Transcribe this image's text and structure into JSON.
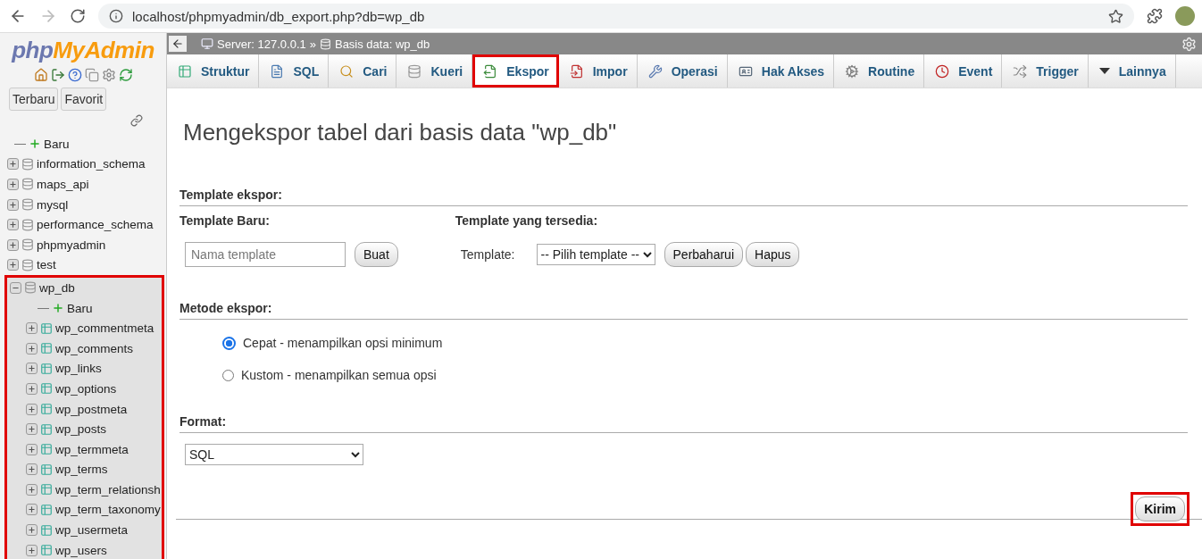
{
  "browser": {
    "url": "localhost/phpmyadmin/db_export.php?db=wp_db"
  },
  "sidebar": {
    "logo": {
      "php": "php",
      "myadmin": "MyAdmin"
    },
    "buttons": [
      "Terbaru",
      "Favorit"
    ],
    "tree": [
      {
        "kind": "new",
        "label": "Baru"
      },
      {
        "kind": "database",
        "label": "information_schema",
        "expanded": false,
        "highlighted": false
      },
      {
        "kind": "database",
        "label": "maps_api",
        "expanded": false,
        "highlighted": false
      },
      {
        "kind": "database",
        "label": "mysql",
        "expanded": false,
        "highlighted": false
      },
      {
        "kind": "database",
        "label": "performance_schema",
        "expanded": false,
        "highlighted": false
      },
      {
        "kind": "database",
        "label": "phpmyadmin",
        "expanded": false,
        "highlighted": false
      },
      {
        "kind": "database",
        "label": "test",
        "expanded": false,
        "highlighted": false
      },
      {
        "kind": "database",
        "label": "wp_db",
        "expanded": true,
        "highlighted": true,
        "children": [
          {
            "kind": "new-table",
            "label": "Baru"
          },
          {
            "kind": "table",
            "label": "wp_commentmeta"
          },
          {
            "kind": "table",
            "label": "wp_comments"
          },
          {
            "kind": "table",
            "label": "wp_links"
          },
          {
            "kind": "table",
            "label": "wp_options"
          },
          {
            "kind": "table",
            "label": "wp_postmeta"
          },
          {
            "kind": "table",
            "label": "wp_posts"
          },
          {
            "kind": "table",
            "label": "wp_termmeta"
          },
          {
            "kind": "table",
            "label": "wp_terms"
          },
          {
            "kind": "table",
            "label": "wp_term_relationsh"
          },
          {
            "kind": "table",
            "label": "wp_term_taxonomy"
          },
          {
            "kind": "table",
            "label": "wp_usermeta"
          },
          {
            "kind": "table",
            "label": "wp_users"
          }
        ]
      }
    ]
  },
  "breadcrumb": {
    "server": "Server: 127.0.0.1",
    "separator": "»",
    "database": "Basis data: wp_db"
  },
  "tabs": [
    {
      "kind": "structure",
      "label": "Struktur",
      "selected": false,
      "highlighted": false
    },
    {
      "kind": "sql",
      "label": "SQL",
      "selected": false,
      "highlighted": false
    },
    {
      "kind": "search",
      "label": "Cari",
      "selected": false,
      "highlighted": false
    },
    {
      "kind": "query",
      "label": "Kueri",
      "selected": false,
      "highlighted": false
    },
    {
      "kind": "export",
      "label": "Ekspor",
      "selected": true,
      "highlighted": true
    },
    {
      "kind": "import",
      "label": "Impor",
      "selected": false,
      "highlighted": false
    },
    {
      "kind": "operations",
      "label": "Operasi",
      "selected": false,
      "highlighted": false
    },
    {
      "kind": "privileges",
      "label": "Hak Akses",
      "selected": false,
      "highlighted": false
    },
    {
      "kind": "routines",
      "label": "Routine",
      "selected": false,
      "highlighted": false
    },
    {
      "kind": "events",
      "label": "Event",
      "selected": false,
      "highlighted": false
    },
    {
      "kind": "triggers",
      "label": "Trigger",
      "selected": false,
      "highlighted": false
    },
    {
      "kind": "more",
      "label": "Lainnya",
      "selected": false,
      "highlighted": false
    }
  ],
  "heading": "Mengekspor tabel dari basis data \"wp_db\"",
  "template_section": {
    "title": "Template ekspor:",
    "new_label": "Template Baru:",
    "name_placeholder": "Nama template",
    "create_button": "Buat",
    "existing_label": "Template yang tersedia:",
    "template_label": "Template:",
    "template_select": "-- Pilih template --",
    "update_button": "Perbaharui",
    "delete_button": "Hapus"
  },
  "method_section": {
    "title": "Metode ekspor:",
    "options": [
      {
        "label": "Cepat - menampilkan opsi minimum",
        "selected": true
      },
      {
        "label": "Kustom - menampilkan semua opsi",
        "selected": false
      }
    ]
  },
  "format_section": {
    "title": "Format:",
    "value": "SQL"
  },
  "submit": {
    "label": "Kirim",
    "highlighted": true
  }
}
